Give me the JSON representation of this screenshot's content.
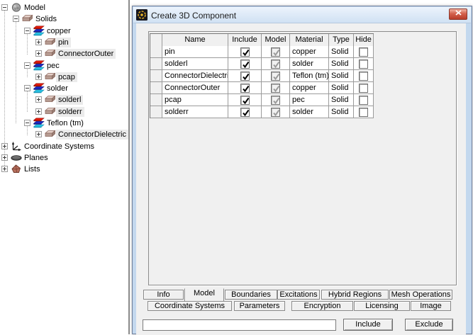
{
  "tree": {
    "items": [
      {
        "label": "Model",
        "depth": 0,
        "expander": "minus",
        "icon": "model",
        "selected": false
      },
      {
        "label": "Solids",
        "depth": 1,
        "expander": "minus",
        "icon": "box",
        "selected": false
      },
      {
        "label": "copper",
        "depth": 2,
        "expander": "minus",
        "icon": "material",
        "selected": false
      },
      {
        "label": "pin",
        "depth": 3,
        "expander": "plus",
        "icon": "box",
        "selected": true
      },
      {
        "label": "ConnectorOuter",
        "depth": 3,
        "expander": "plus",
        "icon": "box",
        "selected": true
      },
      {
        "label": "pec",
        "depth": 2,
        "expander": "minus",
        "icon": "material",
        "selected": false
      },
      {
        "label": "pcap",
        "depth": 3,
        "expander": "plus",
        "icon": "box",
        "selected": true
      },
      {
        "label": "solder",
        "depth": 2,
        "expander": "minus",
        "icon": "material",
        "selected": false
      },
      {
        "label": "solderl",
        "depth": 3,
        "expander": "plus",
        "icon": "box",
        "selected": true
      },
      {
        "label": "solderr",
        "depth": 3,
        "expander": "plus",
        "icon": "box",
        "selected": true
      },
      {
        "label": "Teflon (tm)",
        "depth": 2,
        "expander": "minus",
        "icon": "material",
        "selected": false
      },
      {
        "label": "ConnectorDielectric",
        "depth": 3,
        "expander": "plus",
        "icon": "box",
        "selected": true
      },
      {
        "label": "Coordinate Systems",
        "depth": 0,
        "expander": "plus",
        "icon": "axes",
        "selected": false
      },
      {
        "label": "Planes",
        "depth": 0,
        "expander": "plus",
        "icon": "plane",
        "selected": false
      },
      {
        "label": "Lists",
        "depth": 0,
        "expander": "plus",
        "icon": "lists",
        "selected": false
      }
    ]
  },
  "dialog": {
    "title": "Create 3D Component",
    "close_glyph": "x",
    "table": {
      "headers": [
        "Name",
        "Include",
        "Model",
        "Material",
        "Type",
        "Hide"
      ],
      "rows": [
        {
          "name": "pin",
          "include": true,
          "model": true,
          "material": "copper",
          "type": "Solid",
          "hide": false
        },
        {
          "name": "solderl",
          "include": true,
          "model": true,
          "material": "solder",
          "type": "Solid",
          "hide": false
        },
        {
          "name": "ConnectorDielectric",
          "include": true,
          "model": true,
          "material": "Teflon (tm)",
          "type": "Solid",
          "hide": false
        },
        {
          "name": "ConnectorOuter",
          "include": true,
          "model": true,
          "material": "copper",
          "type": "Solid",
          "hide": false
        },
        {
          "name": "pcap",
          "include": true,
          "model": true,
          "material": "pec",
          "type": "Solid",
          "hide": false
        },
        {
          "name": "solderr",
          "include": true,
          "model": true,
          "material": "solder",
          "type": "Solid",
          "hide": false
        }
      ]
    },
    "tabs_row1": [
      {
        "label": "Info",
        "selected": false
      },
      {
        "label": "Model",
        "selected": true
      },
      {
        "label": "Boundaries",
        "selected": false
      },
      {
        "label": "Excitations",
        "selected": false
      },
      {
        "label": "Hybrid Regions",
        "selected": false
      },
      {
        "label": "Mesh Operations",
        "selected": false
      }
    ],
    "tabs_row2": [
      {
        "label": "Coordinate Systems",
        "selected": false
      },
      {
        "label": "Parameters",
        "selected": false
      },
      {
        "label": "Encryption",
        "selected": false
      },
      {
        "label": "Licensing",
        "selected": false
      },
      {
        "label": "Image",
        "selected": false
      }
    ],
    "search_input": {
      "value": "",
      "placeholder": ""
    },
    "buttons": {
      "include": "Include",
      "exclude": "Exclude"
    },
    "colors": {
      "titlebar": "#d9e7f7",
      "close_button_red": "#c24a37",
      "client_bg": "#f0f0f0",
      "selection_bg": "#ebebeb",
      "material_layer_red": "#e81c0c",
      "material_layer_blue": "#1c28c8",
      "material_layer_cyan": "#28c8e8"
    }
  }
}
